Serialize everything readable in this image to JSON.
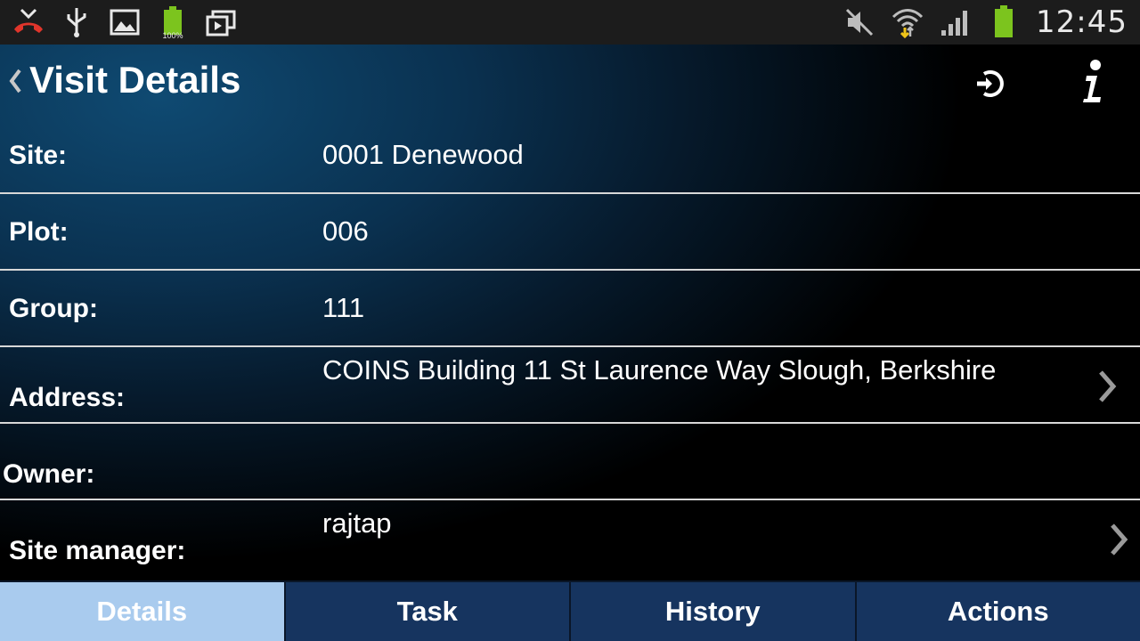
{
  "status_bar": {
    "time": "12:45",
    "battery_label": "100%",
    "icons_left": [
      "missed-call-icon",
      "usb-icon",
      "gallery-icon",
      "battery-full-icon",
      "media-icon"
    ],
    "icons_right": [
      "mute-icon",
      "wifi-icon",
      "signal-icon",
      "battery-icon"
    ]
  },
  "header": {
    "title": "Visit Details",
    "back_icon": "chevron-left-icon",
    "logout_icon": "logout-icon",
    "info_icon": "info-icon"
  },
  "details": [
    {
      "label": "Site:",
      "value": "0001 Denewood"
    },
    {
      "label": "Plot:",
      "value": "006"
    },
    {
      "label": "Group:",
      "value": "111"
    },
    {
      "label": "Address:",
      "value": "COINS Building 11 St Laurence Way Slough, Berkshire"
    },
    {
      "label": "Owner:",
      "value": ""
    },
    {
      "label": "Site manager:",
      "value": "rajtap"
    }
  ],
  "tabs": [
    {
      "label": "Details",
      "active": true
    },
    {
      "label": "Task",
      "active": false
    },
    {
      "label": "History",
      "active": false
    },
    {
      "label": "Actions",
      "active": false
    }
  ],
  "colors": {
    "accent_active_tab": "#a9cbee",
    "tab_background": "#16345f",
    "header_gradient": "#0f4a72",
    "battery_green": "#7cc41e",
    "missed_call_red": "#e0352b"
  }
}
